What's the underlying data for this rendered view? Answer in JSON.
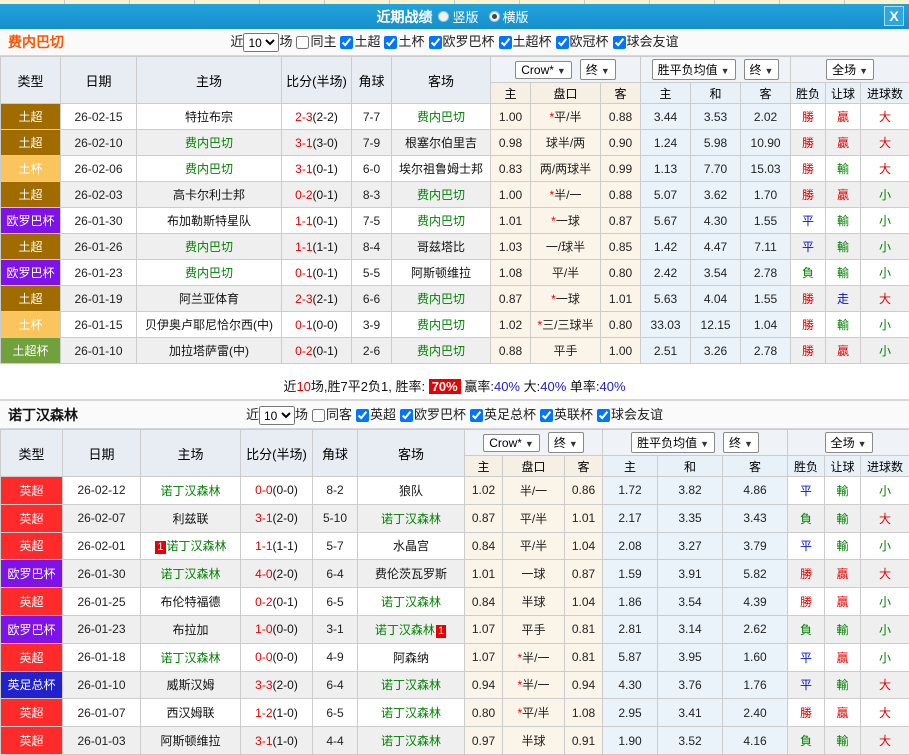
{
  "icons": {
    "dropdown_arrow": "▼",
    "close": "X"
  },
  "colors": {
    "titlebar_blue": "#1798D3",
    "team1_accent": "#FF5500",
    "league_tu_super": "#A06C00",
    "league_tu_cup": "#FBC55E",
    "league_europa": "#7D13E8",
    "league_tu_super_cup": "#70A13C",
    "league_epl": "#FF2B2B",
    "league_fa_cup": "#2121CE"
  },
  "titlebar": {
    "title": "近期战绩",
    "vertical_label": "竖版",
    "horizontal_label": "横版"
  },
  "sections": [
    {
      "team": "费内巴切",
      "controls": {
        "near": "近",
        "count": "10",
        "games": "场",
        "same": "同主",
        "leagues": [
          "土超",
          "土杯",
          "欧罗巴杯",
          "土超杯",
          "欧冠杯",
          "球会友谊"
        ]
      },
      "table": {
        "main_headers": [
          "类型",
          "日期",
          "主场",
          "比分(半场)",
          "角球",
          "客场"
        ],
        "dropdowns": {
          "odds": "Crow*",
          "final1": "终",
          "avg": "胜平负均值",
          "final2": "终",
          "scope": "全场"
        },
        "sub_headers": [
          "主",
          "盘口",
          "客",
          "主",
          "和",
          "客",
          "胜负",
          "让球",
          "进球数"
        ],
        "rows": [
          {
            "league": "土超",
            "league_color": "#A06C00",
            "date": "26-02-15",
            "home": "特拉布宗",
            "home_focus": false,
            "score": "2-3",
            "half": "(2-2)",
            "corner": "7-7",
            "away": "费内巴切",
            "away_focus": true,
            "odds1": "1.00",
            "star": "*",
            "handicap": "平/半",
            "odds2": "0.88",
            "avg_home": "3.44",
            "avg_draw": "3.53",
            "avg_away": "2.02",
            "result": "勝",
            "result_color": "red",
            "let": "贏",
            "let_color": "red",
            "goals": "大",
            "goals_color": "red"
          },
          {
            "league": "土超",
            "league_color": "#A06C00",
            "date": "26-02-10",
            "home": "费内巴切",
            "home_focus": true,
            "score": "3-1",
            "half": "(3-0)",
            "corner": "7-9",
            "away": "根塞尔伯里吉",
            "away_focus": false,
            "odds1": "0.98",
            "star": "",
            "handicap": "球半/两",
            "odds2": "0.90",
            "avg_home": "1.24",
            "avg_draw": "5.98",
            "avg_away": "10.90",
            "result": "勝",
            "result_color": "red",
            "let": "贏",
            "let_color": "red",
            "goals": "大",
            "goals_color": "red"
          },
          {
            "league": "土杯",
            "league_color": "#FBC55E",
            "date": "26-02-06",
            "home": "费内巴切",
            "home_focus": true,
            "score": "3-1",
            "half": "(0-1)",
            "corner": "6-0",
            "away": "埃尔祖鲁姆士邦",
            "away_focus": false,
            "odds1": "0.83",
            "star": "",
            "handicap": "两/两球半",
            "odds2": "0.99",
            "avg_home": "1.13",
            "avg_draw": "7.70",
            "avg_away": "15.03",
            "result": "勝",
            "result_color": "red",
            "let": "輸",
            "let_color": "green",
            "goals": "大",
            "goals_color": "red"
          },
          {
            "league": "土超",
            "league_color": "#A06C00",
            "date": "26-02-03",
            "home": "高卡尔利士邦",
            "home_focus": false,
            "score": "0-2",
            "half": "(0-1)",
            "corner": "8-3",
            "away": "费内巴切",
            "away_focus": true,
            "odds1": "1.00",
            "star": "*",
            "handicap": "半/一",
            "odds2": "0.88",
            "avg_home": "5.07",
            "avg_draw": "3.62",
            "avg_away": "1.70",
            "result": "勝",
            "result_color": "red",
            "let": "贏",
            "let_color": "red",
            "goals": "小",
            "goals_color": "green"
          },
          {
            "league": "欧罗巴杯",
            "league_color": "#7D13E8",
            "date": "26-01-30",
            "home": "布加勒斯特星队",
            "home_focus": false,
            "score": "1-1",
            "half": "(0-1)",
            "corner": "7-5",
            "away": "费内巴切",
            "away_focus": true,
            "odds1": "1.01",
            "star": "*",
            "handicap": "一球",
            "odds2": "0.87",
            "avg_home": "5.67",
            "avg_draw": "4.30",
            "avg_away": "1.55",
            "result": "平",
            "result_color": "blue",
            "let": "輸",
            "let_color": "green",
            "goals": "小",
            "goals_color": "green"
          },
          {
            "league": "土超",
            "league_color": "#A06C00",
            "date": "26-01-26",
            "home": "费内巴切",
            "home_focus": true,
            "score": "1-1",
            "half": "(1-1)",
            "corner": "8-4",
            "away": "哥兹塔比",
            "away_focus": false,
            "odds1": "1.03",
            "star": "",
            "handicap": "一/球半",
            "odds2": "0.85",
            "avg_home": "1.42",
            "avg_draw": "4.47",
            "avg_away": "7.11",
            "result": "平",
            "result_color": "blue",
            "let": "輸",
            "let_color": "green",
            "goals": "小",
            "goals_color": "green"
          },
          {
            "league": "欧罗巴杯",
            "league_color": "#7D13E8",
            "date": "26-01-23",
            "home": "费内巴切",
            "home_focus": true,
            "score": "0-1",
            "half": "(0-1)",
            "corner": "5-5",
            "away": "阿斯顿维拉",
            "away_focus": false,
            "odds1": "1.08",
            "star": "",
            "handicap": "平/半",
            "odds2": "0.80",
            "avg_home": "2.42",
            "avg_draw": "3.54",
            "avg_away": "2.78",
            "result": "負",
            "result_color": "green",
            "let": "輸",
            "let_color": "green",
            "goals": "小",
            "goals_color": "green"
          },
          {
            "league": "土超",
            "league_color": "#A06C00",
            "date": "26-01-19",
            "home": "阿兰亚体育",
            "home_focus": false,
            "score": "2-3",
            "half": "(2-1)",
            "corner": "6-6",
            "away": "费内巴切",
            "away_focus": true,
            "odds1": "0.87",
            "star": "*",
            "handicap": "一球",
            "odds2": "1.01",
            "avg_home": "5.63",
            "avg_draw": "4.04",
            "avg_away": "1.55",
            "result": "勝",
            "result_color": "red",
            "let": "走",
            "let_color": "blue",
            "goals": "大",
            "goals_color": "red"
          },
          {
            "league": "土杯",
            "league_color": "#FBC55E",
            "date": "26-01-15",
            "home": "贝伊奥卢耶尼恰尔西(中)",
            "home_focus": false,
            "score": "0-1",
            "half": "(0-0)",
            "corner": "3-9",
            "away": "费内巴切",
            "away_focus": true,
            "odds1": "1.02",
            "star": "*",
            "handicap": "三/三球半",
            "odds2": "0.80",
            "avg_home": "33.03",
            "avg_draw": "12.15",
            "avg_away": "1.04",
            "result": "勝",
            "result_color": "red",
            "let": "輸",
            "let_color": "green",
            "goals": "小",
            "goals_color": "green"
          },
          {
            "league": "土超杯",
            "league_color": "#70A13C",
            "date": "26-01-10",
            "home": "加拉塔萨雷(中)",
            "home_focus": false,
            "score": "0-2",
            "half": "(0-1)",
            "corner": "2-6",
            "away": "费内巴切",
            "away_focus": true,
            "odds1": "0.88",
            "star": "",
            "handicap": "平手",
            "odds2": "1.00",
            "avg_home": "2.51",
            "avg_draw": "3.26",
            "avg_away": "2.78",
            "result": "勝",
            "result_color": "red",
            "let": "贏",
            "let_color": "red",
            "goals": "小",
            "goals_color": "green"
          }
        ]
      },
      "summary": {
        "near": "近",
        "count": "10",
        "rest": "场,胜7平2负1, 胜率:",
        "win_rate": "70%",
        "win_label": "赢率:",
        "win_pct": "40%",
        "big_label": "大:",
        "big_pct": "40%",
        "single_label": "单率:",
        "single_pct": "40%"
      }
    },
    {
      "team": "诺丁汉森林",
      "controls": {
        "near": "近",
        "count": "10",
        "games": "场",
        "same": "同客",
        "leagues": [
          "英超",
          "欧罗巴杯",
          "英足总杯",
          "英联杯",
          "球会友谊"
        ]
      },
      "table": {
        "main_headers": [
          "类型",
          "日期",
          "主场",
          "比分(半场)",
          "角球",
          "客场"
        ],
        "dropdowns": {
          "odds": "Crow*",
          "final1": "终",
          "avg": "胜平负均值",
          "final2": "终",
          "scope": "全场"
        },
        "sub_headers": [
          "主",
          "盘口",
          "客",
          "主",
          "和",
          "客",
          "胜负",
          "让球",
          "进球数"
        ],
        "rows": [
          {
            "league": "英超",
            "league_color": "#FF2B2B",
            "date": "26-02-12",
            "home": "诺丁汉森林",
            "home_focus": true,
            "score": "0-0",
            "half": "(0-0)",
            "corner": "8-2",
            "away": "狼队",
            "away_focus": false,
            "odds1": "1.02",
            "star": "",
            "handicap": "半/一",
            "odds2": "0.86",
            "avg_home": "1.72",
            "avg_draw": "3.82",
            "avg_away": "4.86",
            "result": "平",
            "result_color": "blue",
            "let": "輸",
            "let_color": "green",
            "goals": "小",
            "goals_color": "green"
          },
          {
            "league": "英超",
            "league_color": "#FF2B2B",
            "date": "26-02-07",
            "home": "利兹联",
            "home_focus": false,
            "score": "3-1",
            "half": "(2-0)",
            "corner": "5-10",
            "away": "诺丁汉森林",
            "away_focus": true,
            "odds1": "0.87",
            "star": "",
            "handicap": "平/半",
            "odds2": "1.01",
            "avg_home": "2.17",
            "avg_draw": "3.35",
            "avg_away": "3.43",
            "result": "負",
            "result_color": "green",
            "let": "輸",
            "let_color": "green",
            "goals": "大",
            "goals_color": "red"
          },
          {
            "league": "英超",
            "league_color": "#FF2B2B",
            "date": "26-02-01",
            "home": "诺丁汉森林",
            "home_focus": true,
            "home_badge": "1",
            "home_badge_pos": "before",
            "score": "1-1",
            "half": "(1-1)",
            "corner": "5-7",
            "away": "水晶宫",
            "away_focus": false,
            "odds1": "0.84",
            "star": "",
            "handicap": "平/半",
            "odds2": "1.04",
            "avg_home": "2.08",
            "avg_draw": "3.27",
            "avg_away": "3.79",
            "result": "平",
            "result_color": "blue",
            "let": "輸",
            "let_color": "green",
            "goals": "小",
            "goals_color": "green"
          },
          {
            "league": "欧罗巴杯",
            "league_color": "#7D13E8",
            "date": "26-01-30",
            "home": "诺丁汉森林",
            "home_focus": true,
            "score": "4-0",
            "half": "(2-0)",
            "corner": "6-4",
            "away": "费伦茨瓦罗斯",
            "away_focus": false,
            "odds1": "1.01",
            "star": "",
            "handicap": "一球",
            "odds2": "0.87",
            "avg_home": "1.59",
            "avg_draw": "3.91",
            "avg_away": "5.82",
            "result": "勝",
            "result_color": "red",
            "let": "贏",
            "let_color": "red",
            "goals": "大",
            "goals_color": "red"
          },
          {
            "league": "英超",
            "league_color": "#FF2B2B",
            "date": "26-01-25",
            "home": "布伦特福德",
            "home_focus": false,
            "score": "0-2",
            "half": "(0-1)",
            "corner": "6-5",
            "away": "诺丁汉森林",
            "away_focus": true,
            "odds1": "0.84",
            "star": "",
            "handicap": "半球",
            "odds2": "1.04",
            "avg_home": "1.86",
            "avg_draw": "3.54",
            "avg_away": "4.39",
            "result": "勝",
            "result_color": "red",
            "let": "贏",
            "let_color": "red",
            "goals": "小",
            "goals_color": "green"
          },
          {
            "league": "欧罗巴杯",
            "league_color": "#7D13E8",
            "date": "26-01-23",
            "home": "布拉加",
            "home_focus": false,
            "score": "1-0",
            "half": "(0-0)",
            "corner": "3-1",
            "away": "诺丁汉森林",
            "away_focus": true,
            "away_badge": "1",
            "away_badge_pos": "after",
            "odds1": "1.07",
            "star": "",
            "handicap": "平手",
            "odds2": "0.81",
            "avg_home": "2.81",
            "avg_draw": "3.14",
            "avg_away": "2.62",
            "result": "負",
            "result_color": "green",
            "let": "輸",
            "let_color": "green",
            "goals": "小",
            "goals_color": "green"
          },
          {
            "league": "英超",
            "league_color": "#FF2B2B",
            "date": "26-01-18",
            "home": "诺丁汉森林",
            "home_focus": true,
            "score": "0-0",
            "half": "(0-0)",
            "corner": "4-9",
            "away": "阿森纳",
            "away_focus": false,
            "odds1": "1.07",
            "star": "*",
            "handicap": "半/一",
            "odds2": "0.81",
            "avg_home": "5.87",
            "avg_draw": "3.95",
            "avg_away": "1.60",
            "result": "平",
            "result_color": "blue",
            "let": "贏",
            "let_color": "red",
            "goals": "小",
            "goals_color": "green"
          },
          {
            "league": "英足总杯",
            "league_color": "#2121CE",
            "date": "26-01-10",
            "home": "威斯汉姆",
            "home_focus": false,
            "score": "3-3",
            "half": "(2-0)",
            "corner": "6-4",
            "away": "诺丁汉森林",
            "away_focus": true,
            "odds1": "0.94",
            "star": "*",
            "handicap": "半/一",
            "odds2": "0.94",
            "avg_home": "4.30",
            "avg_draw": "3.76",
            "avg_away": "1.76",
            "result": "平",
            "result_color": "blue",
            "let": "輸",
            "let_color": "green",
            "goals": "大",
            "goals_color": "red"
          },
          {
            "league": "英超",
            "league_color": "#FF2B2B",
            "date": "26-01-07",
            "home": "西汉姆联",
            "home_focus": false,
            "score": "1-2",
            "half": "(1-0)",
            "corner": "6-5",
            "away": "诺丁汉森林",
            "away_focus": true,
            "odds1": "0.80",
            "star": "*",
            "handicap": "平/半",
            "odds2": "1.08",
            "avg_home": "2.95",
            "avg_draw": "3.41",
            "avg_away": "2.40",
            "result": "勝",
            "result_color": "red",
            "let": "贏",
            "let_color": "red",
            "goals": "大",
            "goals_color": "red"
          },
          {
            "league": "英超",
            "league_color": "#FF2B2B",
            "date": "26-01-03",
            "home": "阿斯顿维拉",
            "home_focus": false,
            "score": "3-1",
            "half": "(1-0)",
            "corner": "4-4",
            "away": "诺丁汉森林",
            "away_focus": true,
            "odds1": "0.97",
            "star": "",
            "handicap": "半球",
            "odds2": "0.91",
            "avg_home": "1.90",
            "avg_draw": "3.52",
            "avg_away": "4.16",
            "result": "負",
            "result_color": "green",
            "let": "輸",
            "let_color": "green",
            "goals": "大",
            "goals_color": "red"
          }
        ]
      },
      "summary": null
    }
  ]
}
